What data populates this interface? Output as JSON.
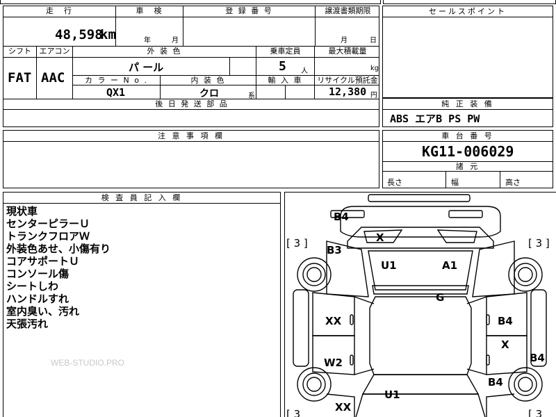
{
  "header": {
    "mileage_label": "走　行",
    "mileage_value": "48,598",
    "mileage_unit": "km",
    "inspection_label": "車　検",
    "inspection_year": "年",
    "inspection_month": "月",
    "registration_label": "登 録 番 号",
    "transfer_label": "譲渡書類期限",
    "transfer_month": "月",
    "transfer_day": "日",
    "sales_point_label": "セールスポイント"
  },
  "specs": {
    "shift_label": "シフト",
    "shift_value": "FAT",
    "ac_label": "エアコン",
    "ac_value": "AAC",
    "exterior_color_label": "外 装 色",
    "exterior_color_value": "パ ール",
    "capacity_label": "乗車定員",
    "capacity_value": "5",
    "capacity_unit": "人",
    "max_load_label": "最大積載量",
    "max_load_unit": "kg",
    "color_no_label": "カ ラ ー N o .",
    "color_no_value": "QX1",
    "interior_color_label": "内 装 色",
    "interior_color_value": "クロ",
    "interior_color_suffix": "系",
    "import_label": "輸 入 車",
    "recycle_label": "リサイクル預託金",
    "recycle_value": "12,380",
    "recycle_unit": "円",
    "later_parts_label": "後 日 発 送 部 品"
  },
  "equipment": {
    "label": "純 正 装 備",
    "value": "ABS エアB PS PW"
  },
  "notes": {
    "label": "注 意 事 項 欄"
  },
  "chassis": {
    "label": "車 台 番 号",
    "value": "KG11-006029",
    "dims_label": "諸 元",
    "length_label": "長さ",
    "width_label": "幅",
    "height_label": "高さ"
  },
  "inspector": {
    "label": "検 査 員 記 入 欄",
    "lines": [
      "現状車",
      "センターピラーＵ",
      "トランクフロアＷ",
      "外装色あせ、小傷有り",
      "コアサポートＵ",
      "コンソール傷",
      "シートしわ",
      "ハンドルすれ",
      "室内臭い、汚れ",
      "天張汚れ"
    ],
    "watermark": "WEB-STUDIO.PRO"
  },
  "diagram": {
    "tire_left_top": "[ 3 ]",
    "tire_right_top": "[ 3 ]",
    "tire_left_bottom": "[ 3",
    "tire_right_bottom": "[ 3",
    "marks": {
      "b4_top": "B4",
      "x_top": "X",
      "b3": "B3",
      "u1_top": "U1",
      "a1": "A1",
      "g": "G",
      "xx_left": "XX",
      "b4_right_mid": "B4",
      "x_right": "X",
      "w2": "W2",
      "b4_edge": "B4",
      "b4_right_low": "B4",
      "u1_bottom": "U1",
      "xx_bottom": "XX"
    }
  }
}
